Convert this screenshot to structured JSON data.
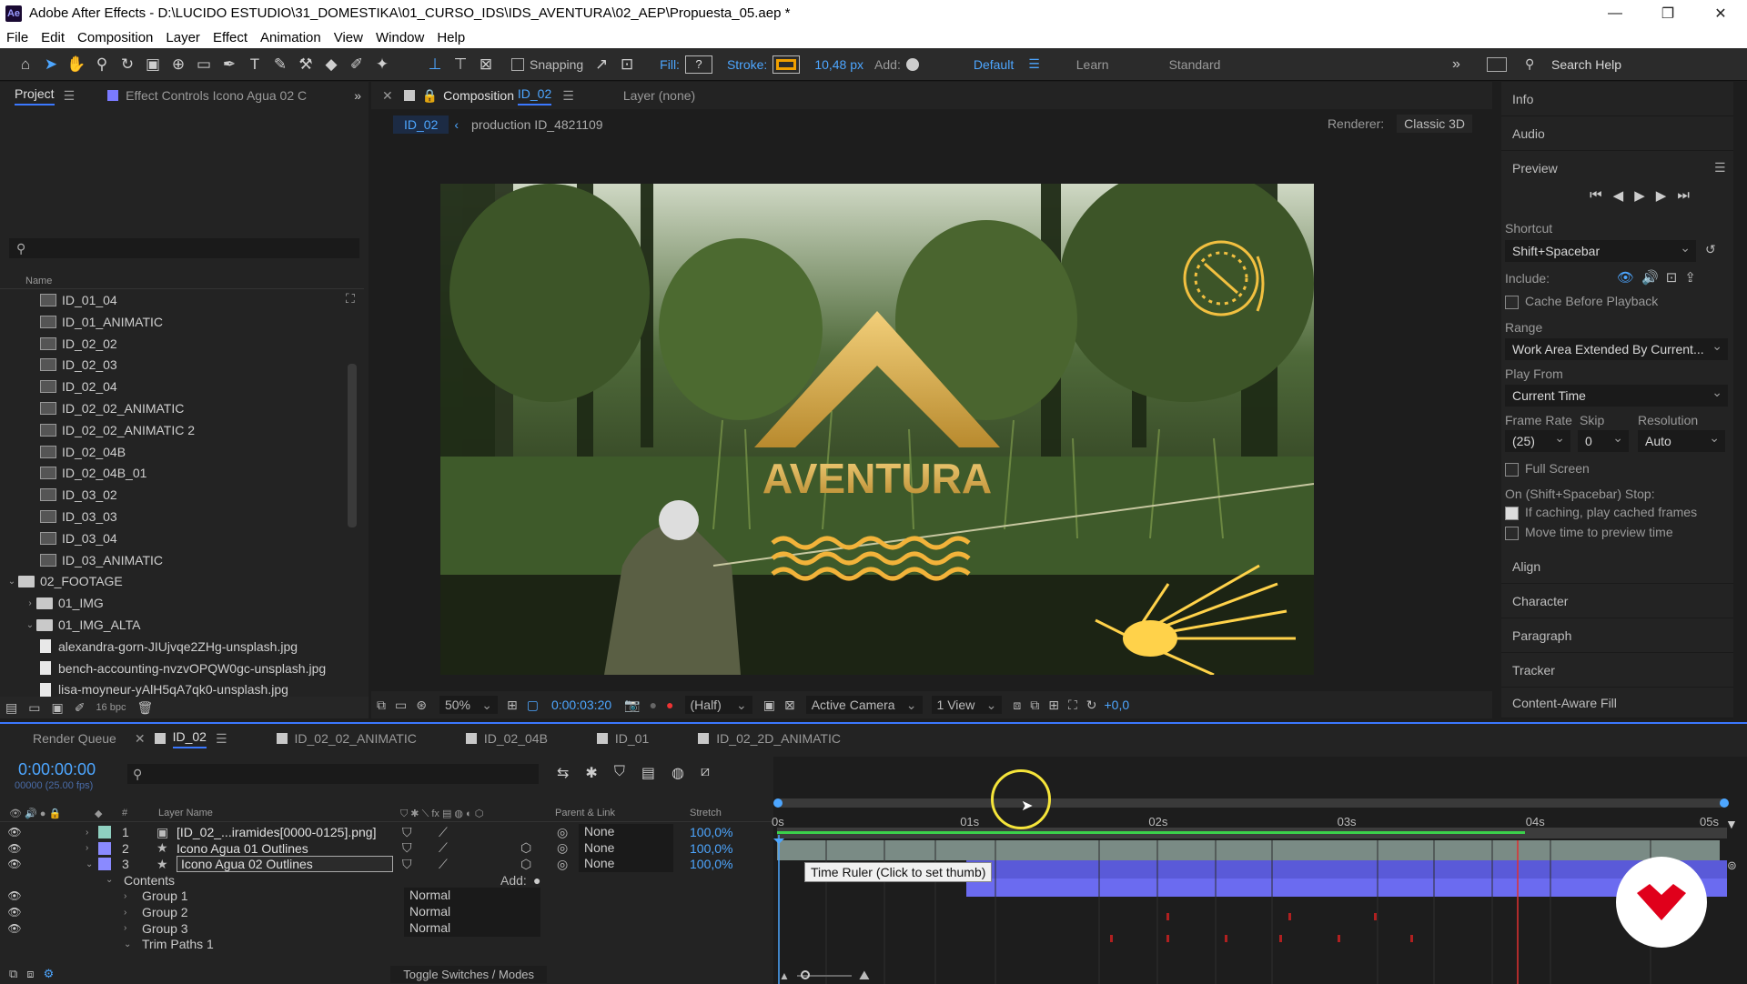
{
  "app": {
    "title": "Adobe After Effects - D:\\LUCIDO ESTUDIO\\31_DOMESTIKA\\01_CURSO_IDS\\IDS_AVENTURA\\02_AEP\\Propuesta_05.aep *",
    "logo": "Ae"
  },
  "menu": [
    "File",
    "Edit",
    "Composition",
    "Layer",
    "Effect",
    "Animation",
    "View",
    "Window",
    "Help"
  ],
  "toolbar": {
    "snapping_label": "Snapping",
    "fill_label": "Fill:",
    "fill_value": "?",
    "stroke_label": "Stroke:",
    "stroke_width": "10,48 px",
    "add_label": "Add:",
    "workspaces": [
      "Default",
      "Learn",
      "Standard"
    ],
    "search_placeholder": "Search Help",
    "stroke_color": "#f0a000"
  },
  "project_panel": {
    "tab_project": "Project",
    "tab_effect_controls": "Effect Controls Icono Agua 02 C",
    "column_name": "Name",
    "items": [
      {
        "name": "ID_01_04",
        "type": "comp",
        "depth": 2
      },
      {
        "name": "ID_01_ANIMATIC",
        "type": "comp",
        "depth": 2
      },
      {
        "name": "ID_02_02",
        "type": "comp",
        "depth": 2
      },
      {
        "name": "ID_02_03",
        "type": "comp",
        "depth": 2
      },
      {
        "name": "ID_02_04",
        "type": "comp",
        "depth": 2
      },
      {
        "name": "ID_02_02_ANIMATIC",
        "type": "comp",
        "depth": 2
      },
      {
        "name": "ID_02_02_ANIMATIC 2",
        "type": "comp",
        "depth": 2
      },
      {
        "name": "ID_02_04B",
        "type": "comp",
        "depth": 2
      },
      {
        "name": "ID_02_04B_01",
        "type": "comp",
        "depth": 2
      },
      {
        "name": "ID_03_02",
        "type": "comp",
        "depth": 2
      },
      {
        "name": "ID_03_03",
        "type": "comp",
        "depth": 2
      },
      {
        "name": "ID_03_04",
        "type": "comp",
        "depth": 2
      },
      {
        "name": "ID_03_ANIMATIC",
        "type": "comp",
        "depth": 2
      },
      {
        "name": "02_FOOTAGE",
        "type": "folder",
        "depth": 0,
        "open": true
      },
      {
        "name": "01_IMG",
        "type": "folder",
        "depth": 1,
        "open": false
      },
      {
        "name": "01_IMG_ALTA",
        "type": "folder",
        "depth": 1,
        "open": true
      },
      {
        "name": "alexandra-gorn-JIUjvqe2ZHg-unsplash.jpg",
        "type": "file",
        "depth": 2
      },
      {
        "name": "bench-accounting-nvzvOPQW0gc-unsplash.jpg",
        "type": "file",
        "depth": 2
      },
      {
        "name": "lisa-moyneur-yAlH5qA7qk0-unsplash.jpg",
        "type": "file",
        "depth": 2
      }
    ],
    "bpc": "16 bpc"
  },
  "composition_panel": {
    "tab_label": "Composition",
    "tab_name": "ID_02",
    "layer_tab": "Layer",
    "layer_value": "(none)",
    "breadcrumb_active": "ID_02",
    "breadcrumb_next": "production ID_4821109",
    "renderer_label": "Renderer:",
    "renderer_value": "Classic 3D",
    "viewer_title": "AVENTURA",
    "zoom": "50%",
    "timecode": "0:00:03:20",
    "resolution": "(Half)",
    "camera": "Active Camera",
    "views": "1 View",
    "exposure": "+0,0"
  },
  "right_panel": {
    "sections_top": [
      "Info",
      "Audio",
      "Preview"
    ],
    "shortcut_label": "Shortcut",
    "shortcut_value": "Shift+Spacebar",
    "include_label": "Include:",
    "cache_before_playback": "Cache Before Playback",
    "range_label": "Range",
    "range_value": "Work Area Extended By Current...",
    "play_from_label": "Play From",
    "play_from_value": "Current Time",
    "frame_rate_label": "Frame Rate",
    "skip_label": "Skip",
    "resolution_label": "Resolution",
    "frame_rate_value": "(25)",
    "skip_value": "0",
    "resolution_value": "Auto",
    "full_screen": "Full Screen",
    "stop_label": "On (Shift+Spacebar) Stop:",
    "if_caching": "If caching, play cached frames",
    "move_time": "Move time to preview time",
    "sections_bottom": [
      "Align",
      "Character",
      "Paragraph",
      "Tracker",
      "Content-Aware Fill"
    ]
  },
  "timeline": {
    "tabs": [
      {
        "label": "Render Queue",
        "color": ""
      },
      {
        "label": "ID_02",
        "color": "#c8c8c8",
        "active": true
      },
      {
        "label": "ID_02_02_ANIMATIC",
        "color": "#c8c8c8"
      },
      {
        "label": "ID_02_04B",
        "color": "#c8c8c8"
      },
      {
        "label": "ID_01",
        "color": "#c8c8c8"
      },
      {
        "label": "ID_02_2D_ANIMATIC",
        "color": "#c8c8c8"
      }
    ],
    "current_time": "0:00:00:00",
    "fps_label": "00000 (25.00 fps)",
    "col_layer_name": "Layer Name",
    "col_hash": "#",
    "col_parent": "Parent & Link",
    "col_stretch": "Stretch",
    "ruler": [
      "0s",
      "01s",
      "02s",
      "03s",
      "04s",
      "05s"
    ],
    "tooltip": "Time Ruler (Click to set thumb)",
    "layers": [
      {
        "num": "1",
        "name": "[ID_02_...iramides[0000-0125].png]",
        "color": "#8fd0c0",
        "parent": "None",
        "stretch": "100,0%"
      },
      {
        "num": "2",
        "name": "Icono Agua 01 Outlines",
        "color": "#8a8aff",
        "parent": "None",
        "stretch": "100,0%"
      },
      {
        "num": "3",
        "name": "Icono Agua 02 Outlines",
        "color": "#8a8aff",
        "parent": "None",
        "stretch": "100,0%"
      }
    ],
    "contents_label": "Contents",
    "add_label": "Add:",
    "groups": [
      {
        "name": "Group 1",
        "mode": "Normal"
      },
      {
        "name": "Group 2",
        "mode": "Normal"
      },
      {
        "name": "Group 3",
        "mode": "Normal"
      }
    ],
    "trim_paths": "Trim Paths 1",
    "toggle_label": "Toggle Switches / Modes"
  }
}
